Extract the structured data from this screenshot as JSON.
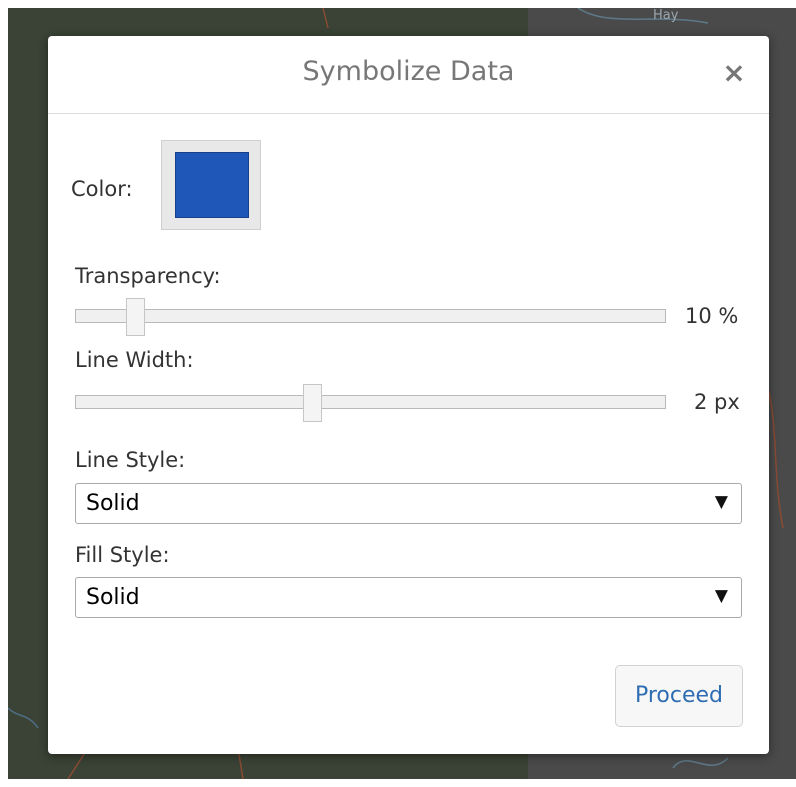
{
  "dialog": {
    "title": "Symbolize Data",
    "close_icon": "×"
  },
  "color": {
    "label": "Color:",
    "value": "#1f57b8"
  },
  "transparency": {
    "label": "Transparency:",
    "value": 10,
    "display": "10 %"
  },
  "line_width": {
    "label": "Line Width:",
    "value": 2,
    "display": "2 px"
  },
  "line_style": {
    "label": "Line Style:",
    "selected": "Solid"
  },
  "fill_style": {
    "label": "Fill Style:",
    "selected": "Solid"
  },
  "actions": {
    "proceed_label": "Proceed"
  },
  "map_labels": {
    "top_right": "Hay"
  },
  "icons": {
    "dropdown": "▼"
  }
}
